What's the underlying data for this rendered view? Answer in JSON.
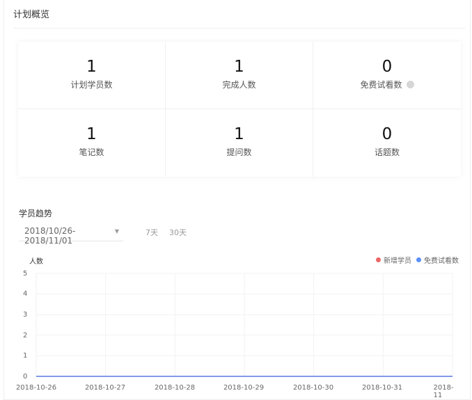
{
  "panel": {
    "title": "计划概览"
  },
  "stats": [
    {
      "value": "1",
      "label": "计划学员数"
    },
    {
      "value": "1",
      "label": "完成人数"
    },
    {
      "value": "0",
      "label": "免费试看数"
    },
    {
      "value": "1",
      "label": "笔记数"
    },
    {
      "value": "1",
      "label": "提问数"
    },
    {
      "value": "0",
      "label": "话题数"
    }
  ],
  "trend": {
    "title": "学员趋势",
    "date_range": "2018/10/26-2018/11/01",
    "range_7": "7天",
    "range_30": "30天"
  },
  "colors": {
    "new_students": "#ee6666",
    "free_trial": "#5b8ff9"
  },
  "chart_data": {
    "type": "line",
    "ylabel": "人数",
    "x": [
      "2018-10-26",
      "2018-10-27",
      "2018-10-28",
      "2018-10-29",
      "2018-10-30",
      "2018-10-31",
      "2018-11"
    ],
    "y_ticks": [
      "5",
      "4",
      "3",
      "2",
      "1",
      "0"
    ],
    "ylim": [
      0,
      5
    ],
    "grid": true,
    "legend": "top-right",
    "series": [
      {
        "name": "新增学员",
        "values": [
          0,
          0,
          0,
          0,
          0,
          0,
          0
        ]
      },
      {
        "name": "免费试看数",
        "values": [
          0,
          0,
          0,
          0,
          0,
          0,
          0
        ]
      }
    ]
  }
}
